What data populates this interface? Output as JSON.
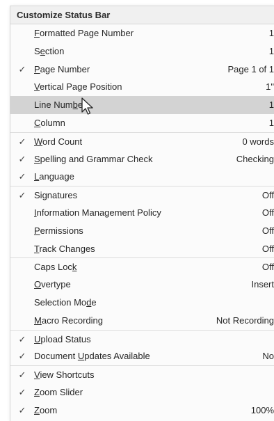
{
  "menu": {
    "title": "Customize Status Bar",
    "items": [
      {
        "pre": "",
        "acc": "F",
        "post": "ormatted Page Number",
        "value": "1",
        "checked": false,
        "sep": false,
        "hover": false
      },
      {
        "pre": "S",
        "acc": "e",
        "post": "ction",
        "value": "1",
        "checked": false,
        "sep": false,
        "hover": false
      },
      {
        "pre": "",
        "acc": "P",
        "post": "age Number",
        "value": "Page 1 of 1",
        "checked": true,
        "sep": false,
        "hover": false
      },
      {
        "pre": "",
        "acc": "V",
        "post": "ertical Page Position",
        "value": "1\"",
        "checked": false,
        "sep": false,
        "hover": false
      },
      {
        "pre": "Line Num",
        "acc": "b",
        "post": "er",
        "value": "1",
        "checked": false,
        "sep": false,
        "hover": true
      },
      {
        "pre": "",
        "acc": "C",
        "post": "olumn",
        "value": "1",
        "checked": false,
        "sep": false,
        "hover": false
      },
      {
        "pre": "",
        "acc": "W",
        "post": "ord Count",
        "value": "0 words",
        "checked": true,
        "sep": true,
        "hover": false
      },
      {
        "pre": "",
        "acc": "S",
        "post": "pelling and Grammar Check",
        "value": "Checking",
        "checked": true,
        "sep": false,
        "hover": false
      },
      {
        "pre": "",
        "acc": "L",
        "post": "anguage",
        "value": "",
        "checked": true,
        "sep": false,
        "hover": false
      },
      {
        "pre": "Si",
        "acc": "g",
        "post": "natures",
        "value": "Off",
        "checked": true,
        "sep": true,
        "hover": false
      },
      {
        "pre": "",
        "acc": "I",
        "post": "nformation Management Policy",
        "value": "Off",
        "checked": false,
        "sep": false,
        "hover": false
      },
      {
        "pre": "",
        "acc": "P",
        "post": "ermissions",
        "value": "Off",
        "checked": false,
        "sep": false,
        "hover": false
      },
      {
        "pre": "",
        "acc": "T",
        "post": "rack Changes",
        "value": "Off",
        "checked": false,
        "sep": false,
        "hover": false
      },
      {
        "pre": "Caps Loc",
        "acc": "k",
        "post": "",
        "value": "Off",
        "checked": false,
        "sep": true,
        "hover": false
      },
      {
        "pre": "",
        "acc": "O",
        "post": "vertype",
        "value": "Insert",
        "checked": false,
        "sep": false,
        "hover": false
      },
      {
        "pre": "Selection Mo",
        "acc": "d",
        "post": "e",
        "value": "",
        "checked": false,
        "sep": false,
        "hover": false
      },
      {
        "pre": "",
        "acc": "M",
        "post": "acro Recording",
        "value": "Not Recording",
        "checked": false,
        "sep": false,
        "hover": false
      },
      {
        "pre": "",
        "acc": "U",
        "post": "pload Status",
        "value": "",
        "checked": true,
        "sep": true,
        "hover": false
      },
      {
        "pre": "Document ",
        "acc": "U",
        "post": "pdates Available",
        "value": "No",
        "checked": true,
        "sep": false,
        "hover": false
      },
      {
        "pre": "",
        "acc": "V",
        "post": "iew Shortcuts",
        "value": "",
        "checked": true,
        "sep": true,
        "hover": false
      },
      {
        "pre": "",
        "acc": "Z",
        "post": "oom Slider",
        "value": "",
        "checked": true,
        "sep": false,
        "hover": false
      },
      {
        "pre": "",
        "acc": "Z",
        "post": "oom",
        "value": "100%",
        "checked": true,
        "sep": false,
        "hover": false
      }
    ]
  },
  "check_glyph": "✓",
  "icons": {
    "check": "check-icon",
    "cursor": "mouse-pointer-icon"
  }
}
